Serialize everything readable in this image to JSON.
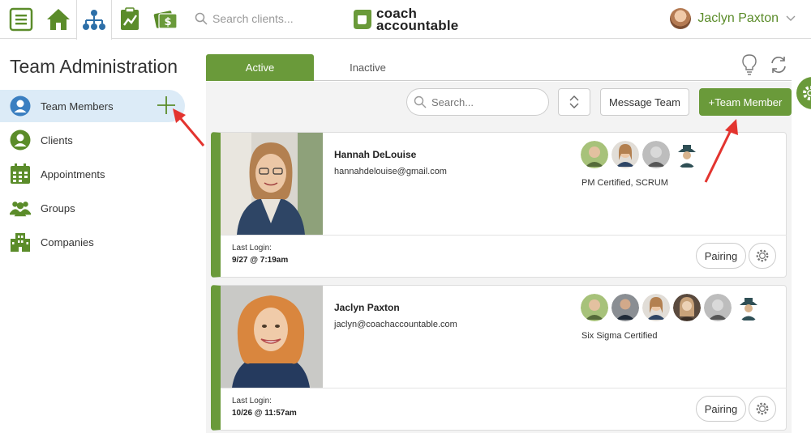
{
  "topbar": {
    "search_placeholder": "Search clients...",
    "brand_line1": "coach",
    "brand_line2": "accountable",
    "user_name": "Jaclyn Paxton",
    "accent": "#6a9a3a"
  },
  "sidebar": {
    "title": "Team Administration",
    "items": [
      {
        "label": "Team Members",
        "icon": "user-icon"
      },
      {
        "label": "Clients",
        "icon": "person-icon"
      },
      {
        "label": "Appointments",
        "icon": "calendar-icon"
      },
      {
        "label": "Groups",
        "icon": "group-icon"
      },
      {
        "label": "Companies",
        "icon": "building-icon"
      }
    ]
  },
  "tabs": {
    "active": "Active",
    "inactive": "Inactive"
  },
  "toolbar": {
    "search_placeholder": "Search...",
    "message_label": "Message Team",
    "add_label": "+Team Member"
  },
  "members": [
    {
      "name": "Hannah DeLouise",
      "email": "hannahdelouise@gmail.com",
      "tags": "PM Certified, SCRUM",
      "login_label": "Last Login:",
      "login_value": "9/27 @ 7:19am",
      "pairing_label": "Pairing"
    },
    {
      "name": "Jaclyn Paxton",
      "email": "jaclyn@coachaccountable.com",
      "tags": "Six Sigma Certified",
      "login_label": "Last Login:",
      "login_value": "10/26 @ 11:57am",
      "pairing_label": "Pairing"
    }
  ]
}
